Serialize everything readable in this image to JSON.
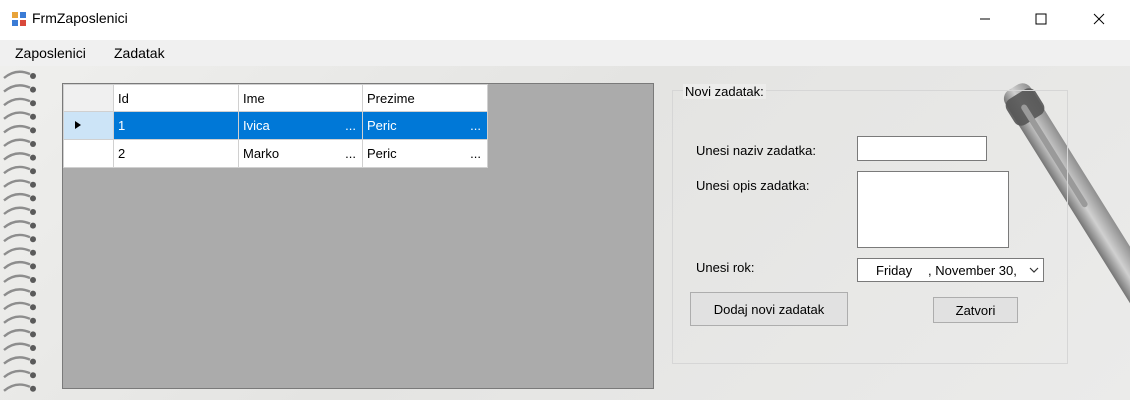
{
  "window": {
    "title": "FrmZaposlenici"
  },
  "menu": [
    {
      "label": "Zaposlenici"
    },
    {
      "label": "Zadatak"
    }
  ],
  "grid": {
    "columns": [
      "Id",
      "Ime",
      "Prezime"
    ],
    "rows": [
      {
        "id": "1",
        "ime": "Ivica",
        "prezime": "Peric",
        "selected": true
      },
      {
        "id": "2",
        "ime": "Marko",
        "prezime": "Peric",
        "selected": false
      }
    ],
    "ellipsis": "..."
  },
  "form": {
    "group_title": "Novi zadatak:",
    "naziv_label": "Unesi naziv zadatka:",
    "naziv_value": "",
    "opis_label": "Unesi opis zadatka:",
    "opis_value": "",
    "rok_label": "Unesi rok:",
    "rok_day": "Friday",
    "rok_date": ", November 30,",
    "add_button": "Dodaj novi zadatak",
    "close_button": "Zatvori"
  },
  "colors": {
    "selection": "#0078d7",
    "grid_bg": "#ababab"
  }
}
